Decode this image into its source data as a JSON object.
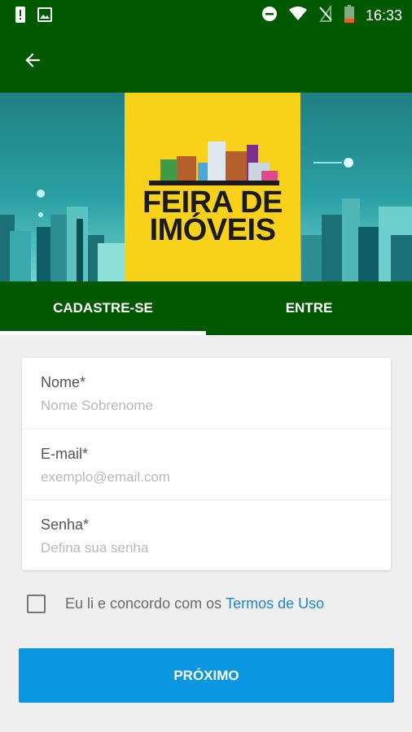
{
  "status_bar": {
    "time": "16:33",
    "icons": [
      "alert-icon",
      "image-icon",
      "do-not-disturb-icon",
      "wifi-icon",
      "no-sim-icon",
      "battery-icon"
    ]
  },
  "header": {
    "back_icon": "arrow-back-icon"
  },
  "banner": {
    "logo_line1": "FEIRA DE",
    "logo_line2": "IMÓVEIS"
  },
  "tabs": [
    {
      "label": "CADASTRE-SE",
      "active": true
    },
    {
      "label": "ENTRE",
      "active": false
    }
  ],
  "form": {
    "fields": [
      {
        "label": "Nome*",
        "placeholder": "Nome Sobrenome",
        "value": ""
      },
      {
        "label": "E-mail*",
        "placeholder": "exemplo@email.com",
        "value": ""
      },
      {
        "label": "Senha*",
        "placeholder": "Defina sua senha",
        "value": ""
      }
    ],
    "terms_text": "Eu li e concordo com os",
    "terms_link": "Termos de Uso",
    "terms_checked": false,
    "submit_label": "PRÓXIMO"
  },
  "colors": {
    "primary": "#005800",
    "button": "#0a97df",
    "link": "#1e88c7",
    "logo_bg": "#fad11a"
  }
}
